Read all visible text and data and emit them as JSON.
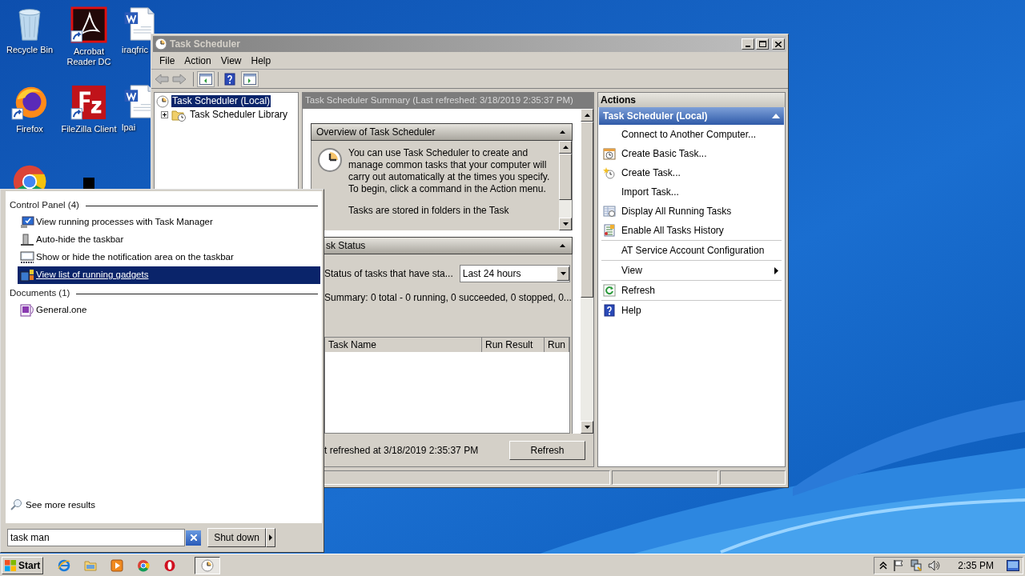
{
  "desktop_icons": [
    {
      "kind": "recycle",
      "label": "Recycle Bin"
    },
    {
      "kind": "acrobat",
      "label": "Acrobat Reader DC"
    },
    {
      "kind": "word",
      "label": "iraqfric"
    },
    {
      "kind": "firefox",
      "label": "Firefox"
    },
    {
      "kind": "filezilla",
      "label": "FileZilla Client"
    },
    {
      "kind": "word",
      "label": "lpai"
    },
    {
      "kind": "chrome"
    },
    {
      "kind": "dark"
    }
  ],
  "window": {
    "title": "Task Scheduler",
    "active": false,
    "menu": [
      "File",
      "Action",
      "View",
      "Help"
    ],
    "tree": [
      {
        "label": "Task Scheduler (Local)",
        "selected": true,
        "children": [
          {
            "label": "Task Scheduler Library",
            "selected": false,
            "expanded": false
          }
        ]
      }
    ],
    "summary_header": "Task Scheduler Summary (Last refreshed: 3/18/2019 2:35:37 PM)",
    "overview": {
      "title": "Overview of Task Scheduler",
      "text": "You can use Task Scheduler to create and manage common tasks that your computer will carry out automatically at the times you specify. To begin, click a command in the Action menu.",
      "text_2": "Tasks are stored in folders in the Task"
    },
    "task_status": {
      "title": "sk Status",
      "filter_label": "Status of tasks that have sta...",
      "filter_value": "Last 24 hours",
      "summary": "Summary: 0 total - 0 running, 0 succeeded, 0 stopped, 0...",
      "columns": [
        "Task Name",
        "Run Result",
        "Run"
      ]
    },
    "last_refreshed": "t refreshed at 3/18/2019 2:35:37 PM",
    "refresh_button": "Refresh",
    "actions": {
      "title": "Actions",
      "group": "Task Scheduler (Local)",
      "expanded": true,
      "groups": [
        [
          {
            "kind": "text",
            "label": "Connect to Another Computer..."
          },
          {
            "kind": "basic_task",
            "label": "Create Basic Task..."
          },
          {
            "kind": "create_task",
            "label": "Create Task..."
          },
          {
            "kind": "text",
            "label": "Import Task..."
          },
          {
            "kind": "running",
            "label": "Display All Running Tasks"
          },
          {
            "kind": "history",
            "label": "Enable All Tasks History"
          }
        ],
        [
          {
            "kind": "text",
            "label": "AT Service Account Configuration"
          }
        ],
        [
          {
            "kind": "submenu",
            "label": "View"
          }
        ],
        [
          {
            "kind": "refresh",
            "label": "Refresh"
          }
        ],
        [
          {
            "kind": "help",
            "label": "Help"
          }
        ]
      ]
    }
  },
  "start_menu": {
    "groups": [
      {
        "title": "Control Panel (4)",
        "items": [
          {
            "kind": "task_manager",
            "label": "View running processes with Task Manager",
            "selected": false
          },
          {
            "kind": "taskbar",
            "label": "Auto-hide the taskbar",
            "selected": false
          },
          {
            "kind": "notification",
            "label": "Show or hide the notification area on the taskbar",
            "selected": false
          },
          {
            "kind": "gadgets",
            "label": "View list of running gadgets",
            "selected": true
          }
        ]
      },
      {
        "title": "Documents (1)",
        "items": [
          {
            "kind": "onenote",
            "label": "General.one",
            "selected": false
          }
        ]
      }
    ],
    "see_more": "See more results",
    "search_value": "task man",
    "shutdown": "Shut down"
  },
  "taskbar": {
    "start": "Start",
    "buttons": [
      {
        "kind": "ie",
        "selected": false
      },
      {
        "kind": "folder",
        "selected": false
      },
      {
        "kind": "media",
        "selected": false
      },
      {
        "kind": "chrome",
        "selected": false
      },
      {
        "kind": "opera",
        "selected": false
      },
      {
        "kind": "clock",
        "selected": true
      }
    ],
    "time": "2:35 PM"
  }
}
